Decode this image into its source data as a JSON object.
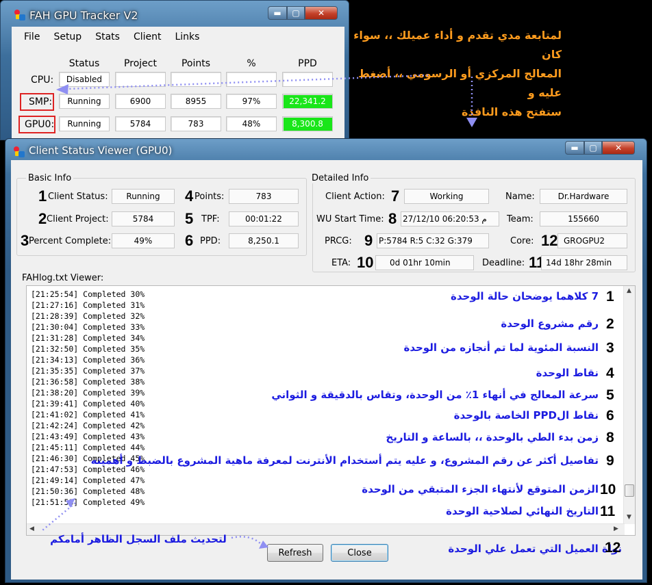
{
  "tracker": {
    "title": "FAH GPU Tracker V2",
    "menu": [
      "File",
      "Setup",
      "Stats",
      "Client",
      "Links"
    ],
    "columns": [
      "Status",
      "Project",
      "Points",
      "%",
      "PPD"
    ],
    "rows": [
      {
        "label": "CPU:",
        "status": "Disabled",
        "project": "",
        "points": "",
        "percent": "",
        "ppd": ""
      },
      {
        "label": "SMP:",
        "status": "Running",
        "project": "6900",
        "points": "8955",
        "percent": "97%",
        "ppd": "22,341.2"
      },
      {
        "label": "GPU0:",
        "status": "Running",
        "project": "5784",
        "points": "783",
        "percent": "48%",
        "ppd": "8,300.8"
      }
    ],
    "ppd_color": "#19e619"
  },
  "annotation_top": [
    "لمتابعة مدي تقدم و أداء عميلك ،، سواء كان",
    "المعالج المركزي أو الرسومي ،، أضغط عليه و",
    "ستفتح هذه النافذة"
  ],
  "viewer": {
    "title": "Client Status Viewer (GPU0)",
    "basic": {
      "group_title": "Basic Info",
      "client_status_label": "Client Status:",
      "client_status": "Running",
      "client_project_label": "Client Project:",
      "client_project": "5784",
      "percent_label": "Percent Complete:",
      "percent": "49%",
      "points_label": "Points:",
      "points": "783",
      "tpf_label": "TPF:",
      "tpf": "00:01:22",
      "ppd_label": "PPD:",
      "ppd": "8,250.1"
    },
    "detailed": {
      "group_title": "Detailed Info",
      "action_label": "Client Action:",
      "action": "Working",
      "wu_label": "WU Start Time:",
      "wu": "27/12/10 06:20:53 م",
      "prcg_label": "PRCG:",
      "prcg": "P:5784  R:5  C:32  G:379",
      "eta_label": "ETA:",
      "eta": "0d 01hr 10min",
      "name_label": "Name:",
      "name": "Dr.Hardware",
      "team_label": "Team:",
      "team": "155660",
      "core_label": "Core:",
      "core": "GROGPU2",
      "deadline_label": "Deadline:",
      "deadline": "14d 18hr 28min"
    },
    "numbers": [
      "1",
      "2",
      "3",
      "4",
      "5",
      "6",
      "7",
      "8",
      "9",
      "10",
      "11",
      "12"
    ],
    "log_title": "FAHlog.txt Viewer:",
    "log": [
      "[21:25:54] Completed 30%",
      "[21:27:16] Completed 31%",
      "[21:28:39] Completed 32%",
      "[21:30:04] Completed 33%",
      "[21:31:28] Completed 34%",
      "[21:32:50] Completed 35%",
      "[21:34:13] Completed 36%",
      "[21:35:35] Completed 37%",
      "[21:36:58] Completed 38%",
      "[21:38:20] Completed 39%",
      "[21:39:41] Completed 40%",
      "[21:41:02] Completed 41%",
      "[21:42:24] Completed 42%",
      "[21:43:49] Completed 43%",
      "[21:45:11] Completed 44%",
      "[21:46:30] Completed 45%",
      "[21:47:53] Completed 46%",
      "[21:49:14] Completed 47%",
      "[21:50:36] Completed 48%",
      "[21:51:58] Completed 49%"
    ],
    "refresh_label": "Refresh",
    "close_label": "Close"
  },
  "annotations": [
    {
      "num": "1",
      "text": "7 كلاهما يوضحان حالة الوحدة"
    },
    {
      "num": "2",
      "text": "رقم مشروع الوحدة"
    },
    {
      "num": "3",
      "text": "النسبة المئوية لما تم أنجازه من الوحدة"
    },
    {
      "num": "4",
      "text": "نقاط الوحدة"
    },
    {
      "num": "5",
      "text": "سرعة المعالج في أنهاء 1٪ من الوحدة، وتقاس بالدقيقة و الثواني"
    },
    {
      "num": "6",
      "text": "نقاط الPPD  الخاصة بالوحدة"
    },
    {
      "num": "8",
      "text": "زمن بدء الطي بالوحدة ،، بالساعة و التاريخ"
    },
    {
      "num": "9",
      "text": "تفاصيل أكثر عن رقم المشروع، و عليه يتم أستخدام الأنترنت لمعرفة ماهية المشروع بالضبط و أهميته"
    },
    {
      "num": "10",
      "text": "الزمن المتوقع لأنتهاء الجزء المتبقي من الوحدة"
    },
    {
      "num": "11",
      "text": "التاريخ النهائي لصلاحية الوحدة"
    }
  ],
  "annotation_12": {
    "num": "12",
    "text": "نواة العميل التي تعمل علي الوحدة"
  },
  "annotation_refresh": "لتحديث ملف السجل الظاهر أمامكم"
}
